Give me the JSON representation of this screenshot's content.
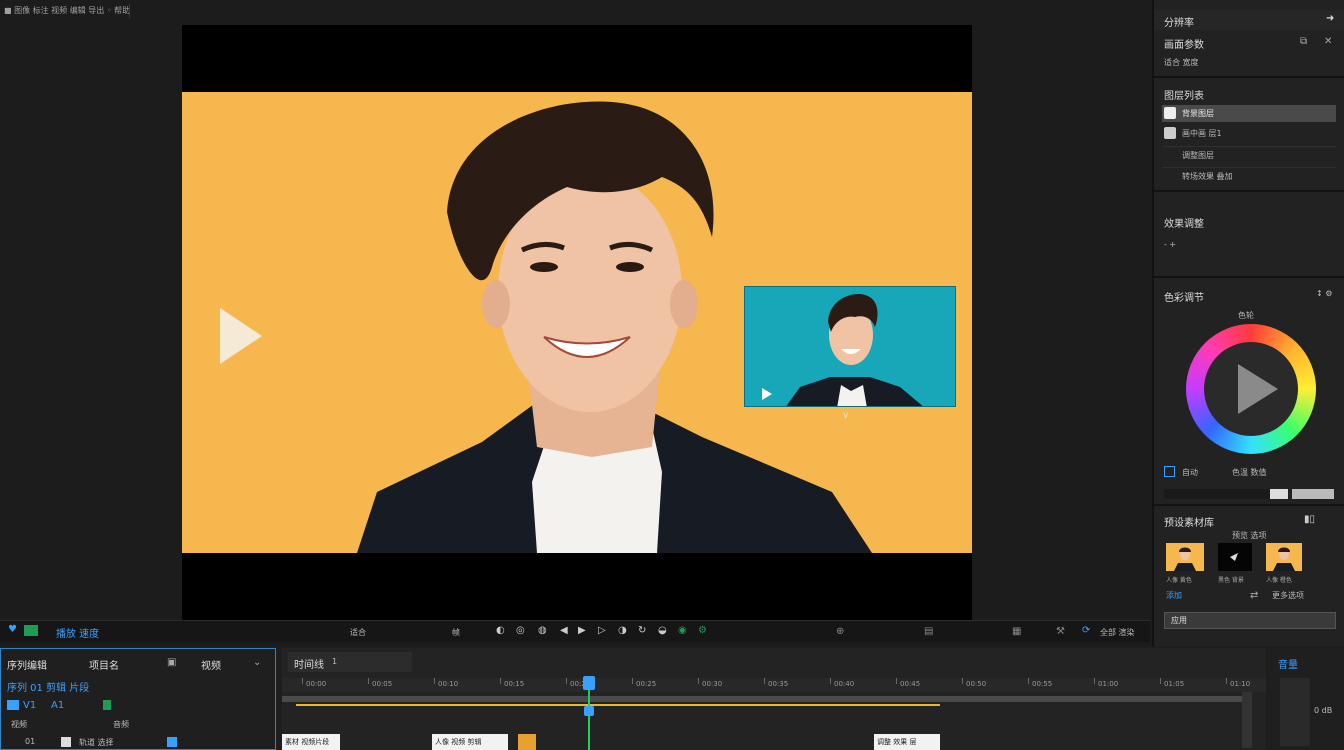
{
  "window": {
    "title_tab": "■ 图像 标注 视频 编辑 导出 ◦ 帮助 ✕"
  },
  "viewer": {
    "play_glyph": "▶",
    "pip_down_glyph": "∨"
  },
  "right_panel": {
    "header": "分辨率",
    "section1_title": "画面参数",
    "section1_sub": "适合 宽度",
    "layers_title": "图层列表",
    "layers": [
      {
        "label": "背景图层",
        "selected": true
      },
      {
        "label": "画中画 层1",
        "selected": false
      },
      {
        "label": "调整图层",
        "selected": false
      },
      {
        "label": "转场效果 叠加",
        "selected": false
      }
    ],
    "adjust_title": "效果调整",
    "adjust_value": "- +",
    "color_title": "色彩调节",
    "color_sub": "色轮",
    "color_corner": "↕ ⚙",
    "wheel_checkbox_label": "自动",
    "wheel_value_label": "色温 数值",
    "presets_title": "预设素材库",
    "presets_subtitle": "预览 选项",
    "presets": [
      {
        "label": "人像 黄色",
        "kind": "orange"
      },
      {
        "label": "黑色 背景",
        "kind": "dark"
      },
      {
        "label": "人像 橙色",
        "kind": "orange"
      }
    ],
    "presets_bottom_left": "添加",
    "presets_bottom_right": "更多选项",
    "apply_label": "应用"
  },
  "control_bar": {
    "left_label": "播放 速度",
    "mid_label": "适合",
    "frame_label": "帧",
    "right_label": "全部 渲染"
  },
  "timeline": {
    "left_header_a": "序列编辑",
    "left_header_b": "项目名",
    "left_header_c": "视频",
    "track_name": "序列 01 剪辑 片段",
    "track_v1": "V1",
    "track_a1": "A1",
    "track_label": "视频",
    "track_label2": "音频",
    "footer_left": "01",
    "footer_mid": "轨道 选择",
    "tab_label": "时间线",
    "tab_extra": "1",
    "ruler_labels": [
      "00:00",
      "00:05",
      "00:10",
      "00:15",
      "00:20",
      "00:25",
      "00:30",
      "00:35",
      "00:40",
      "00:45",
      "00:50",
      "00:55",
      "01:00",
      "01:05",
      "01:10",
      "01:15"
    ],
    "clips": [
      {
        "label": "素材 视频片段"
      },
      {
        "label": "人像 视频 剪辑"
      },
      {
        "label": "调整 效果 层"
      }
    ],
    "right_mini_label": "音量",
    "right_mini_b": "0 dB"
  },
  "colors": {
    "accent_blue": "#3aa0ff",
    "clip_yellow": "#e8b730",
    "photo_bg": "#f6b74e",
    "pip_bg": "#17a7b8"
  }
}
